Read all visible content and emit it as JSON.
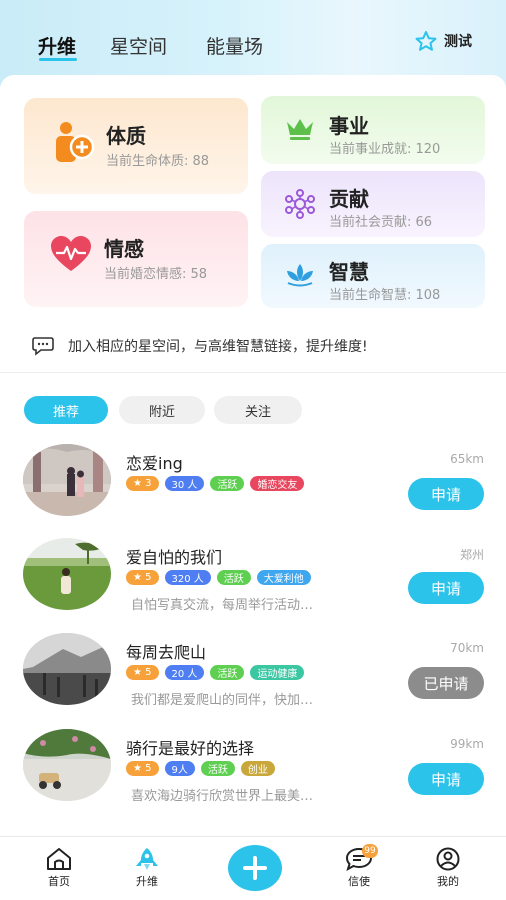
{
  "header": {
    "tabs": [
      {
        "label": "升维",
        "active": true
      },
      {
        "label": "星空间",
        "active": false
      },
      {
        "label": "能量场",
        "active": false
      }
    ],
    "test_label": "测试",
    "test_icon": "star-outline-icon",
    "accent_color": "#2bc3ea"
  },
  "tiles": {
    "constitution": {
      "title": "体质",
      "sub": "当前生命体质: 88",
      "icon": "person-plus-icon",
      "color": "#f38b1e"
    },
    "emotion": {
      "title": "情感",
      "sub": "当前婚恋情感: 58",
      "icon": "heartbeat-icon",
      "color": "#e8475f"
    },
    "career": {
      "title": "事业",
      "sub": "当前事业成就: 120",
      "icon": "crown-icon",
      "color": "#5fbf4b"
    },
    "contribution": {
      "title": "贡献",
      "sub": "当前社会贡献: 66",
      "icon": "network-icon",
      "color": "#9b59d9"
    },
    "wisdom": {
      "title": "智慧",
      "sub": "当前生命智慧: 108",
      "icon": "lotus-icon",
      "color": "#2f9fe0"
    }
  },
  "notice": {
    "text": "加入相应的星空间，与高维智慧链接，提升维度!",
    "icon": "chat-bubble-icon"
  },
  "filters": [
    {
      "label": "推荐",
      "active": true
    },
    {
      "label": "附近",
      "active": false
    },
    {
      "label": "关注",
      "active": false
    }
  ],
  "groups": [
    {
      "title": "恋爱ing",
      "distance": "65km",
      "stars": "3",
      "members": "30 人",
      "status": "活跃",
      "category": "婚恋交友",
      "category_color": "#e8475f",
      "desc": "",
      "action": "申请",
      "applied": false
    },
    {
      "title": "爱自怕的我们",
      "distance": "郑州",
      "stars": "5",
      "members": "320 人",
      "status": "活跃",
      "category": "大爱利他",
      "category_color": "#3fa6f0",
      "desc": "自怕写真交流，每周举行活动…",
      "action": "申请",
      "applied": false
    },
    {
      "title": "每周去爬山",
      "distance": "70km",
      "stars": "5",
      "members": "20 人",
      "status": "活跃",
      "category": "运动健康",
      "category_color": "#3cc7a3",
      "desc": "我们都是爱爬山的同伴，快加…",
      "action": "已申请",
      "applied": true
    },
    {
      "title": "骑行是最好的选择",
      "distance": "99km",
      "stars": "5",
      "members": "9人",
      "status": "活跃",
      "category": "创业",
      "category_color": "#c9a73a",
      "desc": "喜欢海边骑行欣赏世界上最美…",
      "action": "申请",
      "applied": false
    }
  ],
  "nav": {
    "items": [
      {
        "label": "首页",
        "icon": "home-icon"
      },
      {
        "label": "升维",
        "icon": "rocket-icon"
      },
      {
        "label": "信使",
        "icon": "message-icon"
      },
      {
        "label": "我的",
        "icon": "profile-icon"
      }
    ],
    "plus_icon": "plus-icon",
    "badge": "99"
  }
}
